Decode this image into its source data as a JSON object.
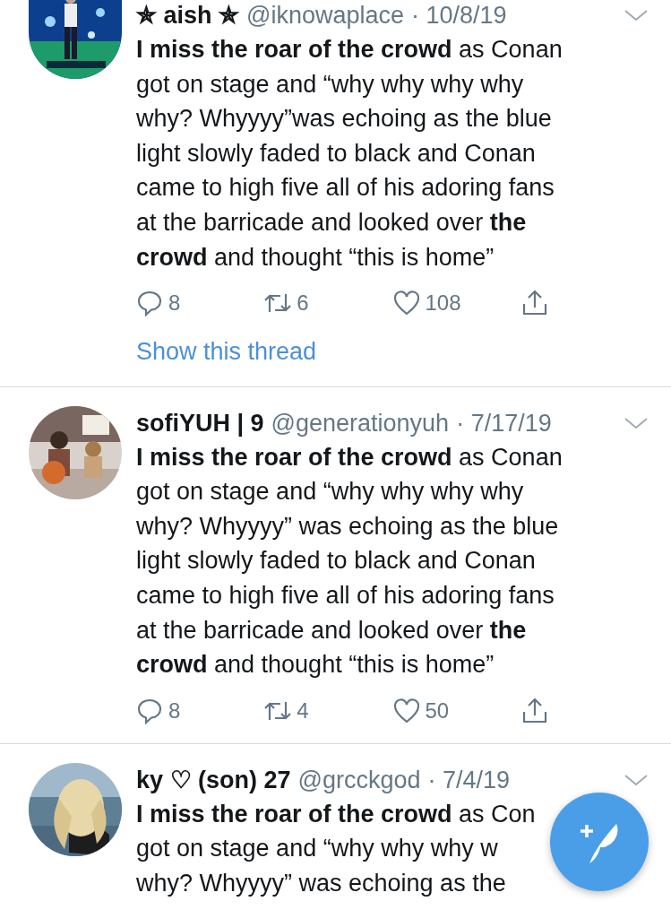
{
  "tweets": [
    {
      "display_name": "✯ aish ✯",
      "handle": "@iknowaplace",
      "date": "· 10/8/19",
      "lines": [
        "**I miss the roar of the crowd** as Conan",
        "got on stage and “why why why why",
        "why? Whyyyy”was echoing as the blue",
        "light slowly faded to black and Conan",
        "came to high five all of his adoring fans",
        "at the barricade and looked over **the**",
        "**crowd** and thought “this is home”"
      ],
      "replies": "8",
      "retweets": "6",
      "likes": "108",
      "thread_link": "Show this thread"
    },
    {
      "display_name": "sofiYUH | 9",
      "handle": "@generationyuh",
      "date": "· 7/17/19",
      "lines": [
        "**I miss the roar of the crowd** as Conan",
        "got on stage and “why why why why",
        "why? Whyyyy” was echoing as the blue",
        "light slowly faded to black and Conan",
        "came to high five all of his adoring fans",
        "at the barricade and looked over **the**",
        "**crowd** and thought “this is home”"
      ],
      "replies": "8",
      "retweets": "4",
      "likes": "50"
    },
    {
      "display_name": "ky ♡ (son) 27",
      "handle": "@grcckgod",
      "date": "· 7/4/19",
      "lines": [
        "**I miss the roar of the crowd** as Con",
        "got on stage and “why why why w",
        "why? Whyyyy” was echoing as the"
      ]
    }
  ]
}
